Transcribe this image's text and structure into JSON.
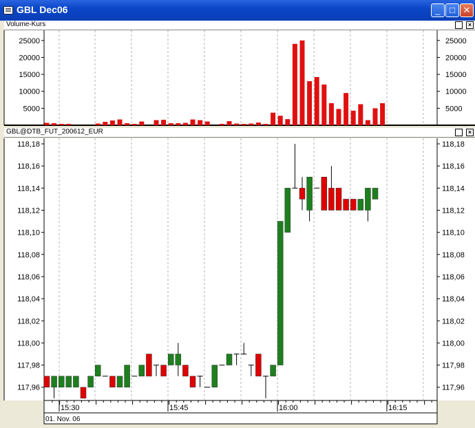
{
  "window": {
    "title": "GBL Dec06",
    "min": "_",
    "max": "□",
    "close": "✕"
  },
  "volume_pane": {
    "label": "Volume-Kurs"
  },
  "price_pane": {
    "label": "GBL@DTB_FUT_200612_EUR"
  },
  "date_label": "01. Nov. 06",
  "colors": {
    "up": "#1e7f1e",
    "down": "#e00000",
    "volume": "#e01010",
    "grid": "#b0b0b0"
  },
  "chart_data": [
    {
      "type": "bar",
      "title": "Volume-Kurs",
      "ylim": [
        0,
        28000
      ],
      "yticks": [
        5000,
        10000,
        15000,
        20000,
        25000
      ],
      "ytick_labels": [
        "5000",
        "10000",
        "15000",
        "20000",
        "25000"
      ],
      "values": [
        700,
        600,
        400,
        400,
        0,
        0,
        0,
        500,
        1000,
        1400,
        1700,
        600,
        400,
        1100,
        0,
        1500,
        1600,
        600,
        600,
        700,
        1700,
        1500,
        1100,
        0,
        400,
        1200,
        500,
        400,
        500,
        800,
        400,
        3700,
        2800,
        1800,
        24000,
        25000,
        13000,
        14200,
        12000,
        6500,
        4800,
        9500,
        4300,
        6200,
        1500,
        5000,
        6500
      ]
    },
    {
      "type": "candlestick",
      "title": "GBL@DTB_FUT_200612_EUR",
      "ylim": [
        117.948,
        118.185
      ],
      "yticks": [
        117.96,
        117.98,
        118.0,
        118.02,
        118.04,
        118.06,
        118.08,
        118.1,
        118.12,
        118.14,
        118.16,
        118.18
      ],
      "ytick_labels": [
        "117,96",
        "117,98",
        "118,00",
        "118,02",
        "118,04",
        "118,06",
        "118,08",
        "118,10",
        "118,12",
        "118,14",
        "118,16",
        "118,18"
      ],
      "xtick_labels": [
        "15:30",
        "15:45",
        "16:00",
        "16:15"
      ],
      "interval_minutes": 1,
      "ohlc": [
        [
          117.97,
          117.97,
          117.96,
          117.96
        ],
        [
          117.96,
          117.97,
          117.95,
          117.97
        ],
        [
          117.96,
          117.97,
          117.96,
          117.97
        ],
        [
          117.96,
          117.97,
          117.96,
          117.97
        ],
        [
          117.96,
          117.97,
          117.96,
          117.97
        ],
        [
          117.96,
          117.96,
          117.95,
          117.95
        ],
        [
          117.96,
          117.97,
          117.96,
          117.97
        ],
        [
          117.97,
          117.98,
          117.97,
          117.98
        ],
        [
          117.97,
          117.97,
          117.97,
          117.97
        ],
        [
          117.97,
          117.97,
          117.96,
          117.96
        ],
        [
          117.96,
          117.97,
          117.96,
          117.97
        ],
        [
          117.96,
          117.98,
          117.96,
          117.98
        ],
        [
          117.97,
          117.97,
          117.97,
          117.97
        ],
        [
          117.97,
          117.98,
          117.97,
          117.98
        ],
        [
          117.99,
          117.99,
          117.97,
          117.97
        ],
        [
          117.98,
          117.98,
          117.97,
          117.98
        ],
        [
          117.98,
          117.98,
          117.97,
          117.97
        ],
        [
          117.98,
          117.99,
          117.98,
          117.99
        ],
        [
          117.98,
          118.0,
          117.97,
          117.99
        ],
        [
          117.98,
          117.98,
          117.97,
          117.97
        ],
        [
          117.97,
          117.97,
          117.96,
          117.96
        ],
        [
          117.97,
          117.97,
          117.96,
          117.97
        ],
        [
          117.96,
          117.96,
          117.96,
          117.96
        ],
        [
          117.96,
          117.98,
          117.96,
          117.98
        ],
        [
          117.98,
          117.98,
          117.98,
          117.98
        ],
        [
          117.98,
          117.99,
          117.98,
          117.99
        ],
        [
          117.99,
          117.99,
          117.98,
          117.99
        ],
        [
          117.99,
          118.0,
          117.99,
          117.99
        ],
        [
          117.98,
          117.98,
          117.97,
          117.98
        ],
        [
          117.99,
          117.99,
          117.97,
          117.97
        ],
        [
          117.97,
          117.97,
          117.95,
          117.97
        ],
        [
          117.97,
          117.98,
          117.97,
          117.98
        ],
        [
          117.98,
          118.11,
          117.98,
          118.11
        ],
        [
          118.1,
          118.14,
          118.1,
          118.14
        ],
        [
          118.14,
          118.18,
          118.14,
          118.14
        ],
        [
          118.14,
          118.15,
          118.12,
          118.13
        ],
        [
          118.12,
          118.15,
          118.11,
          118.15
        ],
        [
          118.14,
          118.14,
          118.14,
          118.14
        ],
        [
          118.15,
          118.15,
          118.12,
          118.12
        ],
        [
          118.14,
          118.16,
          118.12,
          118.12
        ],
        [
          118.14,
          118.14,
          118.12,
          118.12
        ],
        [
          118.13,
          118.13,
          118.12,
          118.12
        ],
        [
          118.13,
          118.13,
          118.12,
          118.12
        ],
        [
          118.12,
          118.13,
          118.12,
          118.13
        ],
        [
          118.12,
          118.14,
          118.11,
          118.14
        ],
        [
          118.13,
          118.14,
          118.13,
          118.14
        ]
      ]
    }
  ]
}
